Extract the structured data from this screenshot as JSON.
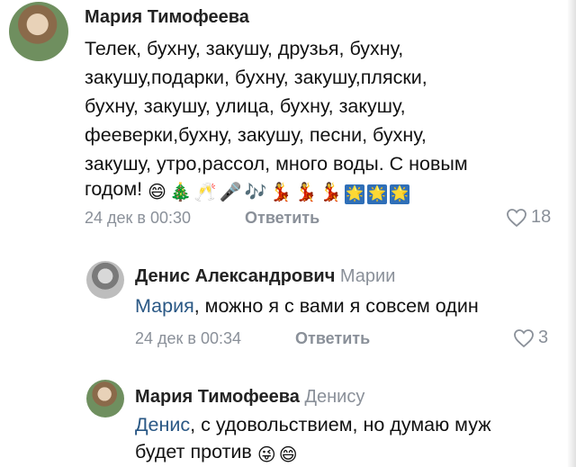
{
  "comments": [
    {
      "author": "Мария Тимофеева",
      "lines": [
        "Телек, бухну, закушу, друзья, бухну,",
        "закушу,подарки, бухну, закушу,пляски,",
        "бухну, закушу, улица, бухну, закушу,",
        "фееверки,бухну, закушу, песни, бухну,",
        "закушу, утро,рассол, много воды. С новым",
        "годом!"
      ],
      "emojis": [
        "😄",
        "🎄",
        "🥂",
        "🎤",
        "🎶",
        "💃",
        "💃",
        "💃",
        "🌟",
        "🌟",
        "🌟"
      ],
      "date": "24 дек в 00:30",
      "reply_label": "Ответить",
      "likes": "18"
    },
    {
      "author": "Денис Александрович",
      "reply_to": "Марии",
      "mention": "Мария",
      "text": ", можно я с вами я совсем  один",
      "date": "24 дек в 00:34",
      "reply_label": "Ответить",
      "likes": "3"
    },
    {
      "author": "Мария Тимофеева",
      "reply_to": "Денису",
      "mention": "Денис",
      "text": ", с удовольствием, но думаю муж",
      "text2": "будет против",
      "emojis": [
        "😜",
        "😄"
      ]
    }
  ]
}
